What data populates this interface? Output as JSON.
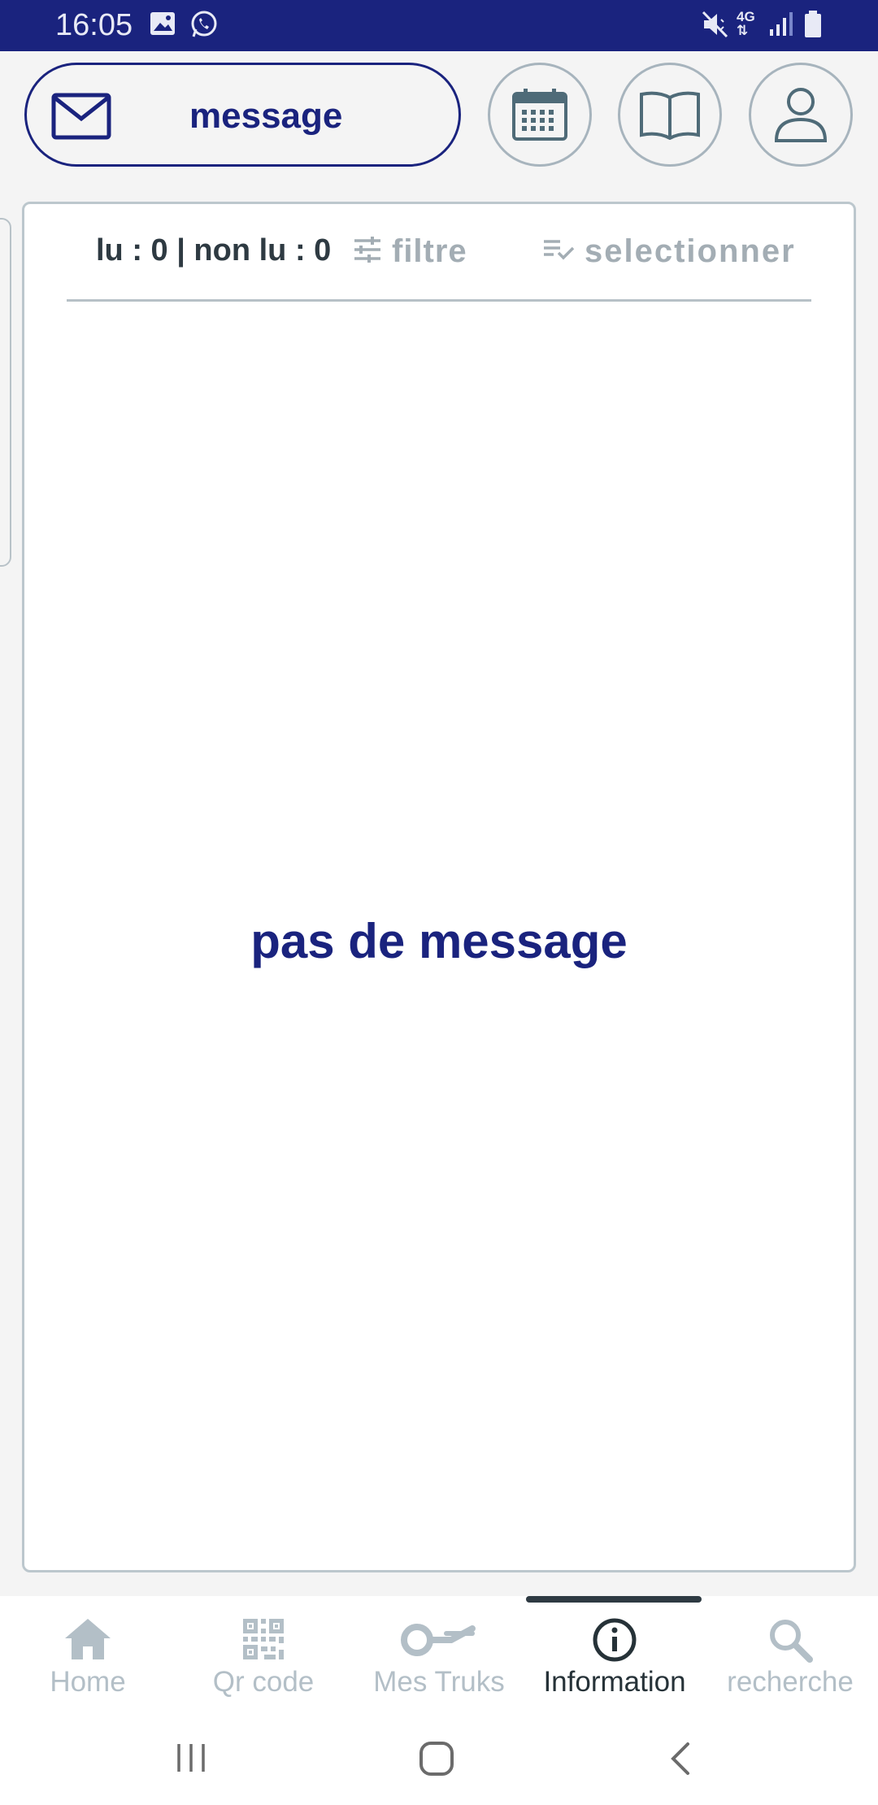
{
  "status_bar": {
    "time": "16:05",
    "left_icons": [
      "image-icon",
      "whatsapp-icon"
    ],
    "right_icons": [
      "mute-icon",
      "4g-icon",
      "signal-icon",
      "battery-icon"
    ],
    "network": "4G",
    "bg_color": "#1a237e"
  },
  "header": {
    "message_button_label": "message",
    "buttons": [
      "calendar-icon",
      "book-icon",
      "user-icon"
    ],
    "accent_color": "#1a237e"
  },
  "toolbar": {
    "counts": "lu : 0 | non lu : 0",
    "filter_label": "filtre",
    "select_label": "selectionner"
  },
  "main": {
    "empty_message": "pas de message"
  },
  "bottom_nav": {
    "items": [
      {
        "label": "Home",
        "icon": "home-icon"
      },
      {
        "label": "Qr code",
        "icon": "qr-code-icon"
      },
      {
        "label": "Mes Truks",
        "icon": "key-icon"
      },
      {
        "label": "Information",
        "icon": "info-icon"
      },
      {
        "label": "recherche",
        "icon": "search-icon"
      }
    ],
    "active": "Information"
  },
  "system_nav": [
    "recent-apps-icon",
    "home-button-icon",
    "back-icon"
  ]
}
